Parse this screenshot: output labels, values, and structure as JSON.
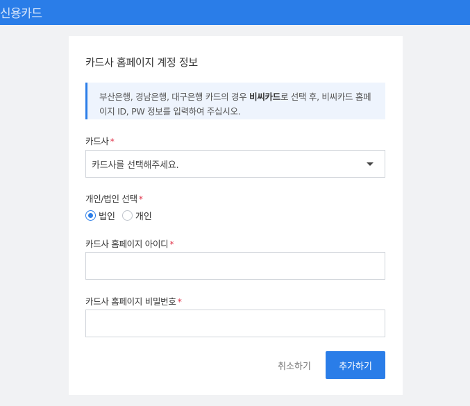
{
  "header": {
    "title": "신용카드",
    "bg_color": "#2a7de8"
  },
  "form": {
    "title": "카드사 홈페이지 계정 정보",
    "notice": {
      "before": "부산은행, 경남은행, 대구은행 카드의 경우 ",
      "bold": "비씨카드",
      "after": "로 선택 후, 비씨카드 홈페이지 ID, PW 정보를 입력하여 주십시오."
    },
    "card_company": {
      "label": "카드사",
      "required": "*",
      "value": "카드사를 선택해주세요."
    },
    "type": {
      "label": "개인/법인 선택",
      "required": "*",
      "options": [
        {
          "label": "법인",
          "checked": true
        },
        {
          "label": "개인",
          "checked": false
        }
      ]
    },
    "user_id": {
      "label": "카드사 홈페이지 아이디",
      "required": "*",
      "value": ""
    },
    "password": {
      "label": "카드사 홈페이지 비밀번호",
      "required": "*",
      "value": ""
    },
    "buttons": {
      "cancel": "취소하기",
      "add": "추가하기"
    }
  },
  "colors": {
    "accent": "#2a7de8",
    "required": "#e0344a",
    "background": "#f1f2f4"
  }
}
